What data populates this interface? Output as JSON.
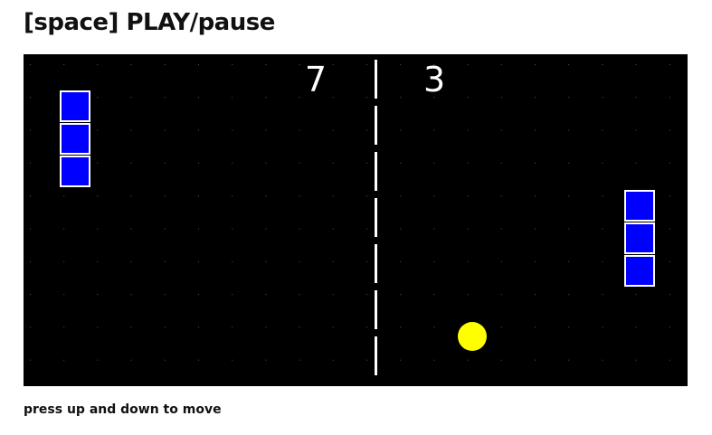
{
  "header": {
    "title": "[space] PLAY/pause"
  },
  "game": {
    "score_left": "7",
    "score_right": "3",
    "colors": {
      "background": "#000000",
      "paddle_fill": "#0000ff",
      "paddle_border": "#ffffff",
      "ball": "#ffff00",
      "net": "#ffffff",
      "grid_dots": "#555555"
    },
    "paddles": [
      {
        "name": "left-paddle",
        "segments": 3
      },
      {
        "name": "right-paddle",
        "segments": 3
      }
    ]
  },
  "footer": {
    "hint": "press up and down to move"
  }
}
